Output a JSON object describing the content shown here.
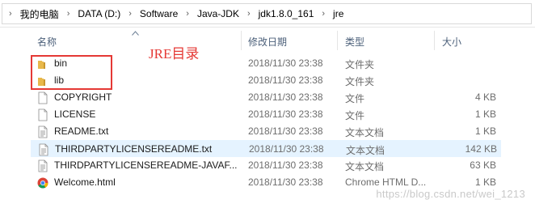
{
  "breadcrumb": [
    "我的电脑",
    "DATA (D:)",
    "Software",
    "Java-JDK",
    "jdk1.8.0_161",
    "jre"
  ],
  "columns": {
    "name": "名称",
    "date": "修改日期",
    "type": "类型",
    "size": "大小"
  },
  "files": [
    {
      "name": "bin",
      "date": "2018/11/30 23:38",
      "type": "文件夹",
      "size": "",
      "icon": "folder-icon",
      "selected": false
    },
    {
      "name": "lib",
      "date": "2018/11/30 23:38",
      "type": "文件夹",
      "size": "",
      "icon": "folder-icon",
      "selected": false
    },
    {
      "name": "COPYRIGHT",
      "date": "2018/11/30 23:38",
      "type": "文件",
      "size": "4 KB",
      "icon": "file-icon",
      "selected": false
    },
    {
      "name": "LICENSE",
      "date": "2018/11/30 23:38",
      "type": "文件",
      "size": "1 KB",
      "icon": "file-icon",
      "selected": false
    },
    {
      "name": "README.txt",
      "date": "2018/11/30 23:38",
      "type": "文本文档",
      "size": "1 KB",
      "icon": "text-file-icon",
      "selected": false
    },
    {
      "name": "THIRDPARTYLICENSEREADME.txt",
      "date": "2018/11/30 23:38",
      "type": "文本文档",
      "size": "142 KB",
      "icon": "text-file-icon",
      "selected": true
    },
    {
      "name": "THIRDPARTYLICENSEREADME-JAVAF...",
      "date": "2018/11/30 23:38",
      "type": "文本文档",
      "size": "63 KB",
      "icon": "text-file-icon",
      "selected": false
    },
    {
      "name": "Welcome.html",
      "date": "2018/11/30 23:38",
      "type": "Chrome HTML D...",
      "size": "1 KB",
      "icon": "chrome-icon",
      "selected": false
    }
  ],
  "annotation": {
    "label": "JRE目录"
  },
  "watermark": "https://blog.csdn.net/wei_1213",
  "colors": {
    "selection": "#e5f3ff",
    "annotation": "#e53935",
    "folder": "#e8b84a",
    "header_text": "#4c607a"
  }
}
